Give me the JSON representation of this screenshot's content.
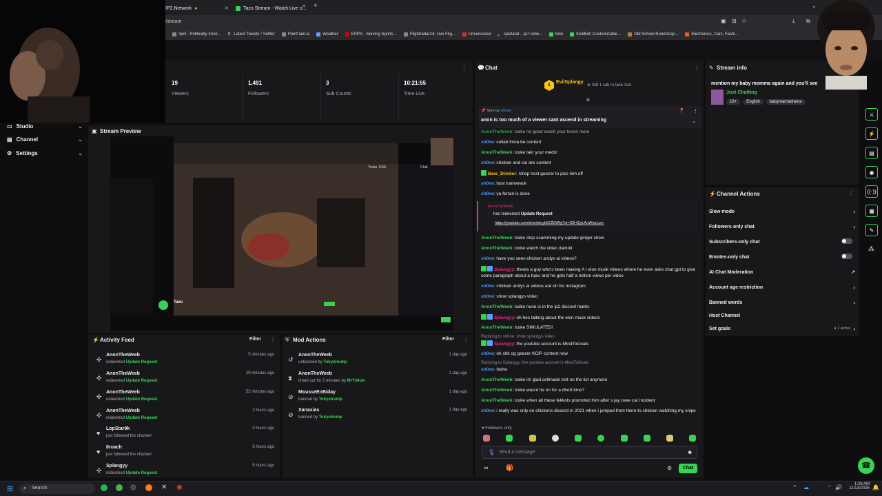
{
  "browser": {
    "tabs": [
      {
        "label": "IP2.Network"
      },
      {
        "label": "Tazo Stream - Watch Live o..."
      }
    ],
    "url": "/stream",
    "bookmarks": [
      "/pol/ - Politically Incor...",
      "Latest Tweets / Twitter",
      "Pomf.lain.la",
      "Weather",
      "ESPN - Serving Sports...",
      "Flightradar24: Live Flig...",
      "Uncensored",
      "spicland ...ip7.netw...",
      "Kick",
      "KickBot: Customizable...",
      "Old School RuneScap...",
      "Electronics, Cars, Fashi..."
    ]
  },
  "sidebar": {
    "items": [
      {
        "label": "Studio"
      },
      {
        "label": "Channel"
      },
      {
        "label": "Settings"
      }
    ]
  },
  "stats": [
    {
      "value": "19",
      "label": "Viewers"
    },
    {
      "value": "1,491",
      "label": "Followers"
    },
    {
      "value": "3",
      "label": "Sub Counts"
    },
    {
      "value": "10:21:55",
      "label": "Time Live"
    }
  ],
  "preview": {
    "title": "Stream Preview",
    "inner_name": "Tazo",
    "inner_chat_label": "Chat",
    "inner_location": "Texas, USA"
  },
  "activity_feed": {
    "title": "Activity Feed",
    "filter_label": "Filter",
    "items": [
      {
        "icon": "redeem-icon",
        "name": "AnonTheWeeb",
        "action": "redeemed",
        "detail": "Update Request",
        "time": "5 minutes ago"
      },
      {
        "icon": "redeem-icon",
        "name": "AnonTheWeeb",
        "action": "redeemed",
        "detail": "Update Request",
        "time": "29 minutes ago"
      },
      {
        "icon": "redeem-icon",
        "name": "AnonTheWeeb",
        "action": "redeemed",
        "detail": "Update Request",
        "time": "52 minutes ago"
      },
      {
        "icon": "redeem-icon",
        "name": "AnonTheWeeb",
        "action": "redeemed",
        "detail": "Update Request",
        "time": "2 hours ago"
      },
      {
        "icon": "heart-icon",
        "name": "LopStar9k",
        "action": "just followed the channel",
        "detail": "",
        "time": "4 hours ago"
      },
      {
        "icon": "heart-icon",
        "name": "8roach",
        "action": "just followed the channel",
        "detail": "",
        "time": "5 hours ago"
      },
      {
        "icon": "redeem-icon",
        "name": "Splangyy",
        "action": "redeemed",
        "detail": "Update Request",
        "time": "5 hours ago"
      }
    ]
  },
  "mod_actions": {
    "title": "Mod Actions",
    "filter_label": "Filter",
    "items": [
      {
        "icon": "unban-icon",
        "name": "AnonTheWeeb",
        "action": "unbanned by",
        "mod": "Tokyotrump",
        "time": "1 day ago"
      },
      {
        "icon": "timeout-icon",
        "name": "AnonTheWeeb",
        "action": "timed out for 2 minutes by",
        "mod": "MrYellow",
        "time": "1 day ago"
      },
      {
        "icon": "ban-icon",
        "name": "MousseEnBiday",
        "action": "banned by",
        "mod": "Tokyotrump",
        "time": "1 day ago"
      },
      {
        "icon": "ban-icon",
        "name": "Xanaxias",
        "action": "banned by",
        "mod": "Tokyotrump",
        "time": "1 day ago"
      }
    ]
  },
  "chat": {
    "title": "Chat",
    "gift": {
      "user": "EvilSplangy",
      "rank": "1",
      "text": "Gift 1 sub to take 2nd"
    },
    "pinned": {
      "sent_by_prefix": "Sent by",
      "sent_by": "sh0ne",
      "text": "anon is too much of a viewer cant ascend in streaming"
    },
    "messages": [
      {
        "user": "AnonTheWeeb",
        "color": "#39d353",
        "text": ": lcoke no good watch your heros more"
      },
      {
        "user": "sh0ne",
        "color": "#4a9cff",
        "text": ": collab finna be content"
      },
      {
        "user": "AnonTheWeeb",
        "color": "#39d353",
        "text": ": lcoke takr your meds!"
      },
      {
        "user": "sh0ne",
        "color": "#4a9cff",
        "text": ": chicken and ice are content"
      },
      {
        "user": "Beer_Drinker",
        "color": "#f5c518",
        "text": ": !chop host geezer to piss him off"
      },
      {
        "user": "sh0ne",
        "color": "#4a9cff",
        "text": ": host trainwreck"
      },
      {
        "user": "sh0ne",
        "color": "#4a9cff",
        "text": ": ya ferrari is done"
      },
      {
        "user": "AnonTheWeeb",
        "color": "#39d353",
        "text": ": lcoke stop scamming my update ginger chew"
      },
      {
        "user": "AnonTheWeeb",
        "color": "#39d353",
        "text": ": lcoke watch the video damnit"
      },
      {
        "user": "sh0ne",
        "color": "#4a9cff",
        "text": ": have you seen chicken andys ai videos?"
      },
      {
        "user": "Splangyy",
        "color": "#e0317c",
        "text": ": theres a guy who's been making A I elon musk videos where he even asks chat gpt to give some paragraph about a topic and he gets half a million views per video"
      },
      {
        "user": "sh0ne",
        "color": "#4a9cff",
        "text": ": chicken andys ai videos are on his instagram"
      },
      {
        "user": "sh0ne",
        "color": "#4a9cff",
        "text": ": show splangys video"
      },
      {
        "user": "AnonTheWeeb",
        "color": "#39d353",
        "text": ": lcoke nune is in the ip2 discord matrix"
      },
      {
        "user": "Splangyy",
        "color": "#e0317c",
        "text": ": oh hes talking about the elon musk videos"
      },
      {
        "user": "AnonTheWeeb",
        "color": "#39d353",
        "text": ": lcoke SIMULATED!"
      },
      {
        "user": "Splangyy",
        "color": "#e0317c",
        "text": ": the youtube account is MindToGoals"
      },
      {
        "user": "sh0ne",
        "color": "#4a9cff",
        "text": ": oh shit og geezer KCIP content now"
      },
      {
        "user": "sh0ne",
        "color": "#4a9cff",
        "text": ": fasho"
      },
      {
        "user": "AnonTheWeeb",
        "color": "#39d353",
        "text": ": lcoke im glad cellmade isnt on the list anymore"
      },
      {
        "user": "AnonTheWeeb",
        "color": "#39d353",
        "text": ": lcoke wasnt he on for a dhort time?"
      },
      {
        "user": "AnonTheWeeb",
        "color": "#39d353",
        "text": ": lcoke when all these fekkots promoted him after s jay ceee car incident"
      },
      {
        "user": "sh0ne",
        "color": "#4a9cff",
        "text": ": i really was only on chickens discord in 2021 when i jumped from there to chicken watching my snipe"
      }
    ],
    "redeem": {
      "user": "AnonTheWeeb",
      "prefix": "has redeemed",
      "reward": "Update Request",
      "link": "https://youtube.com/shorts/uyb6Z2DtWg?si=GB-GlyLAuWnpLznr"
    },
    "replies": [
      "Replying to sh0ne: show splangys video",
      "Replying to Splangyy: the youtube account is MindToGoals"
    ],
    "followers_only": "Followers only",
    "input_placeholder": "Send a message",
    "send_label": "Chat"
  },
  "stream_info": {
    "title": "Stream info",
    "stream_title": "mention my baby momma again and you'll see",
    "category": "Just Chatting",
    "tags": [
      "18+",
      "English",
      "babymamadrama"
    ]
  },
  "channel_actions": {
    "title": "Channel Actions",
    "items": [
      {
        "label": "Slow mode",
        "control": "chevron"
      },
      {
        "label": "Followers-only chat",
        "control": "chevron"
      },
      {
        "label": "Subscribers-only chat",
        "control": "toggle"
      },
      {
        "label": "Emotes-only chat",
        "control": "toggle"
      },
      {
        "label": "AI Chat Moderation",
        "control": "external"
      },
      {
        "label": "Account age restriction",
        "control": "chevron"
      },
      {
        "label": "Banned words",
        "control": "chevron"
      },
      {
        "label": "Host Channel",
        "control": "none"
      },
      {
        "label": "Set goals",
        "control": "chevron",
        "status": "1 active"
      }
    ]
  },
  "taskbar": {
    "search_placeholder": "Search",
    "time": "1:28 AM",
    "date": "11/13/2025"
  },
  "colors": {
    "accent": "#39d353",
    "bg": "#0e0e10",
    "panel": "#18181b"
  }
}
